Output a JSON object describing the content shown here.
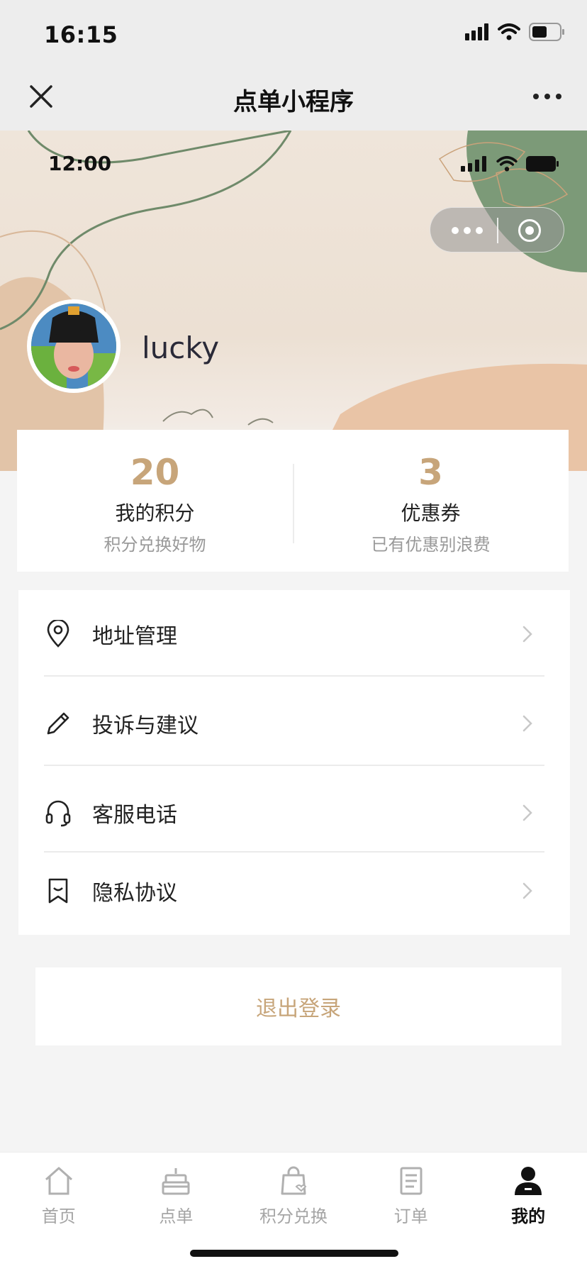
{
  "system_status": {
    "time": "16:15"
  },
  "nav": {
    "title": "点单小程序",
    "close_icon": "close-icon",
    "more_icon": "more-icon"
  },
  "hero": {
    "inner_time": "12:00"
  },
  "profile": {
    "username": "lucky"
  },
  "stats": [
    {
      "value": "20",
      "label": "我的积分",
      "sub": "积分兑换好物"
    },
    {
      "value": "3",
      "label": "优惠券",
      "sub": "已有优惠别浪费"
    }
  ],
  "menu": [
    {
      "label": "地址管理",
      "icon": "location-pin-icon"
    },
    {
      "label": "投诉与建议",
      "icon": "pencil-icon"
    },
    {
      "label": "客服电话",
      "icon": "headset-icon"
    },
    {
      "label": "隐私协议",
      "icon": "bookmark-icon"
    }
  ],
  "logout_label": "退出登录",
  "tabs": [
    {
      "label": "首页",
      "icon": "home-icon"
    },
    {
      "label": "点单",
      "icon": "cake-icon"
    },
    {
      "label": "积分兑换",
      "icon": "shopping-bag-icon"
    },
    {
      "label": "订单",
      "icon": "document-icon"
    },
    {
      "label": "我的",
      "icon": "user-icon",
      "active": true
    }
  ],
  "colors": {
    "accent": "#c7a57a",
    "background": "#f4f4f4",
    "header_bar": "#ededed"
  }
}
